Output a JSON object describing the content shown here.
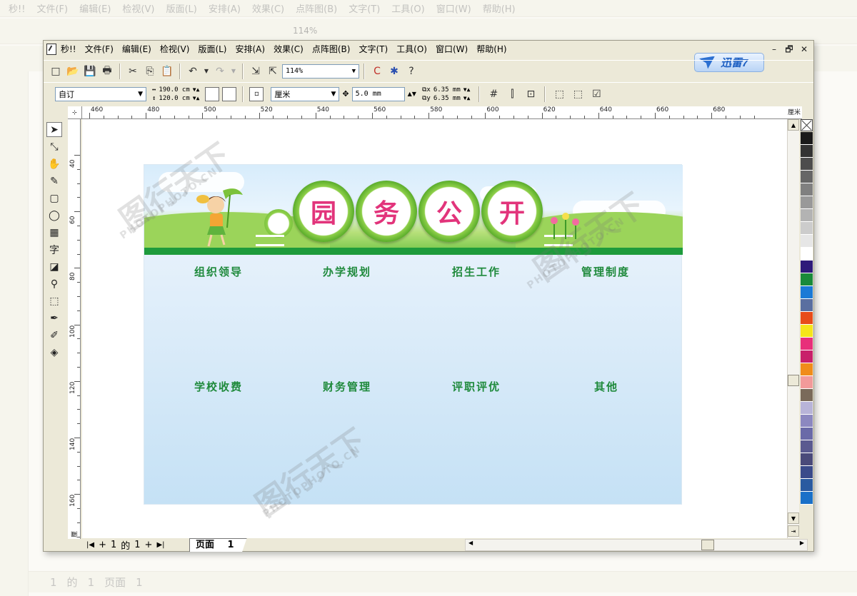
{
  "background_window": {
    "title": "秒!!",
    "menu": [
      "文件(F)",
      "编辑(E)",
      "检视(V)",
      "版面(L)",
      "安排(A)",
      "效果(C)",
      "点阵图(B)",
      "文字(T)",
      "工具(O)",
      "窗口(W)",
      "帮助(H)"
    ],
    "zoom": "114%",
    "pager_current": "1",
    "pager_of": "的",
    "pager_total": "1",
    "page_tab": "页面",
    "page_num": "1"
  },
  "window": {
    "title": "秒!!",
    "menu": [
      "文件(F)",
      "编辑(E)",
      "检视(V)",
      "版面(L)",
      "安排(A)",
      "效果(C)",
      "点阵图(B)",
      "文字(T)",
      "工具(O)",
      "窗口(W)",
      "帮助(H)"
    ],
    "controls": [
      "–",
      "🗗",
      "✕"
    ]
  },
  "thunder_badge": "迅雷7",
  "toolbar": {
    "zoom_value": "114%"
  },
  "property_bar": {
    "paper_preset": "自订",
    "width": "190.0 cm",
    "height": "120.0 cm",
    "units": "厘米",
    "nudge": "5.0 mm",
    "dup_x": "6.35 mm",
    "dup_y": "6.35 mm"
  },
  "ruler": {
    "h_labels": [
      "460",
      "480",
      "500",
      "520",
      "540",
      "560",
      "580",
      "600",
      "620",
      "640",
      "660",
      "680"
    ],
    "h_unit": "厘米",
    "v_labels": [
      "40",
      "60",
      "80",
      "100",
      "120",
      "140",
      "160"
    ],
    "v_unit": "厘米"
  },
  "design": {
    "banner_chars": [
      "园",
      "务",
      "公",
      "开"
    ],
    "categories_row1": [
      "组织领导",
      "办学规划",
      "招生工作",
      "管理制度"
    ],
    "categories_row2": [
      "学校收费",
      "财务管理",
      "评职评优",
      "其他"
    ]
  },
  "watermark": {
    "cn": "图行天下",
    "en": "PHOTOPHOTO.CN"
  },
  "statusbar": {
    "pager_current": "1",
    "pager_of": "的",
    "pager_total": "1",
    "page_tab": "页面",
    "page_num": "1"
  },
  "palette_colors": [
    "#1a1a1a",
    "#333333",
    "#4d4d4d",
    "#666666",
    "#808080",
    "#999999",
    "#b3b3b3",
    "#cccccc",
    "#e6e6e6",
    "#ffffff",
    "#2e1a7a",
    "#1a8a3a",
    "#1b7ad6",
    "#5a6fa0",
    "#e84c1a",
    "#f5e51a",
    "#e8307a",
    "#c8206a",
    "#f08c1a",
    "#f29a9a",
    "#7a6a5a",
    "#b8b4d8",
    "#8c88c0",
    "#6a6aa8",
    "#5a5a90",
    "#4a4a7a",
    "#3a4a8a",
    "#2a5aa0",
    "#1a70c8"
  ]
}
